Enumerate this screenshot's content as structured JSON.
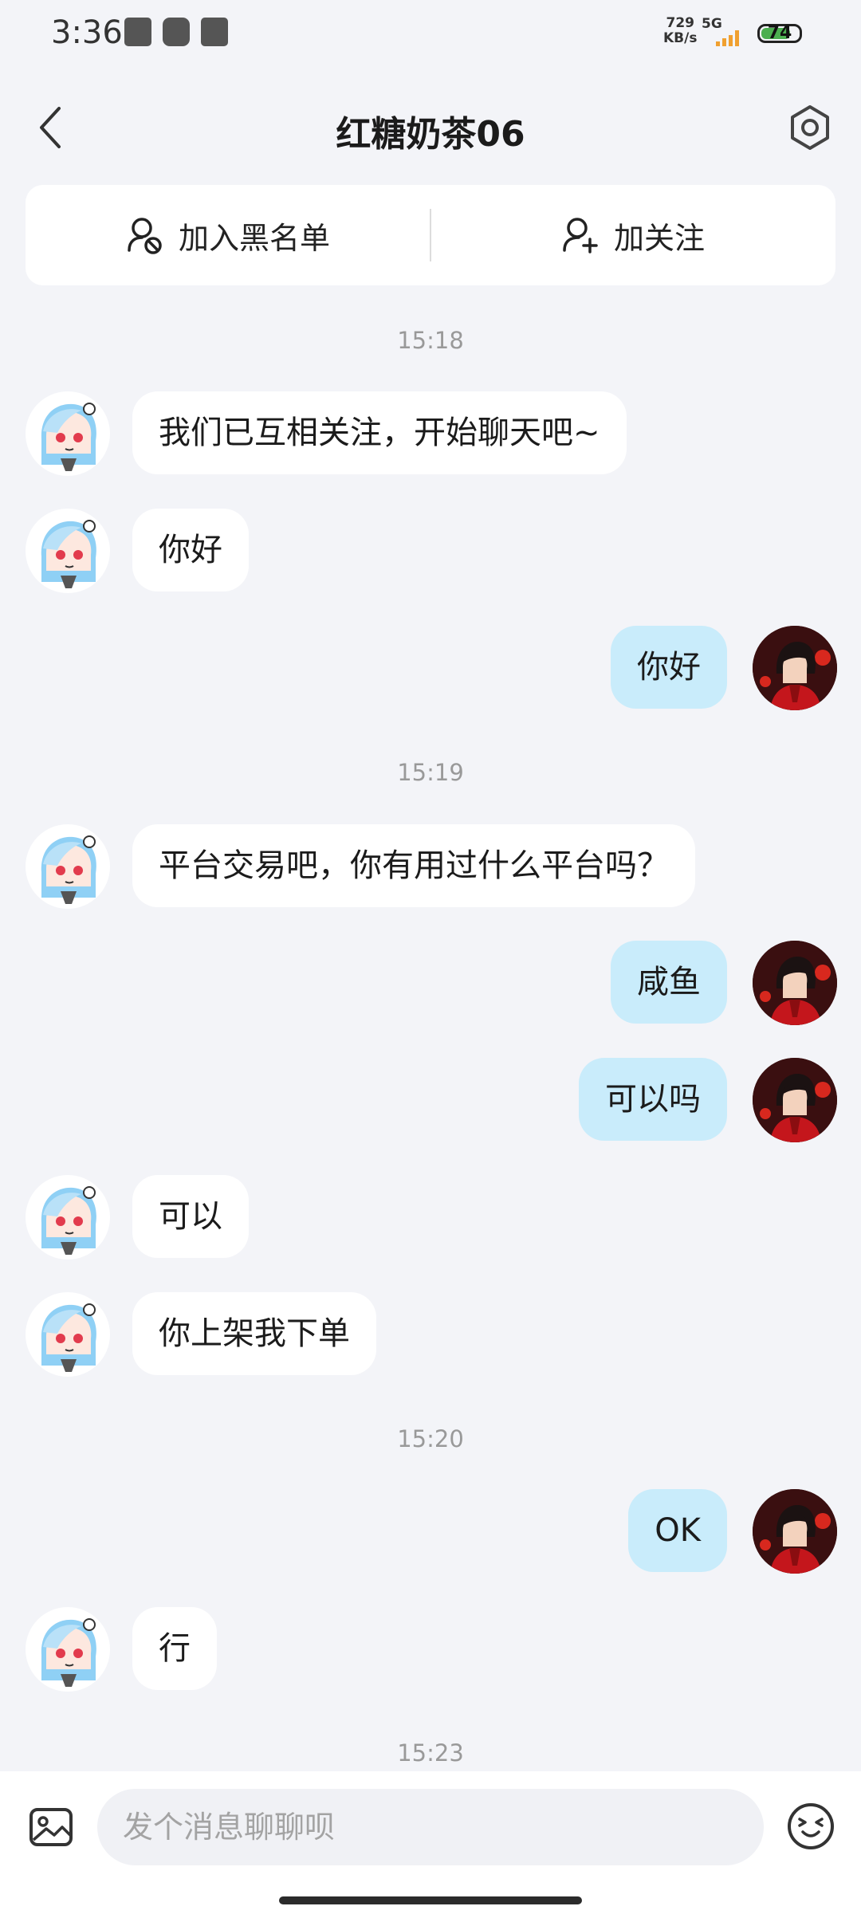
{
  "status": {
    "time": "3:36",
    "net_speed": "729",
    "net_unit": "KB/s",
    "network": "5G",
    "battery": "74",
    "battery_level_percent": 74
  },
  "header": {
    "title": "红糖奶茶06"
  },
  "actions": {
    "blacklist_label": "加入黑名单",
    "follow_label": "加关注"
  },
  "chat": {
    "ts1": "15:18",
    "ts2": "15:19",
    "ts3": "15:20",
    "ts4": "15:23",
    "msg1": "我们已互相关注，开始聊天吧~",
    "msg2": "你好",
    "msg3": "你好",
    "msg4": "平台交易吧，你有用过什么平台吗？",
    "msg5": "咸鱼",
    "msg6": "可以吗",
    "msg7": "可以",
    "msg8": "你上架我下单",
    "msg9": "OK",
    "msg10": "行"
  },
  "input": {
    "placeholder": "发个消息聊聊呗"
  },
  "colors": {
    "background": "#f3f4f8",
    "sent_bubble": "#c9ecfb",
    "received_bubble": "#ffffff",
    "timestamp": "#999999"
  },
  "icons": {
    "back": "back-arrow-icon",
    "settings": "hexagon-settings-icon",
    "blacklist": "block-user-icon",
    "follow": "add-user-icon",
    "gallery": "image-icon",
    "emoji": "emoji-icon"
  }
}
